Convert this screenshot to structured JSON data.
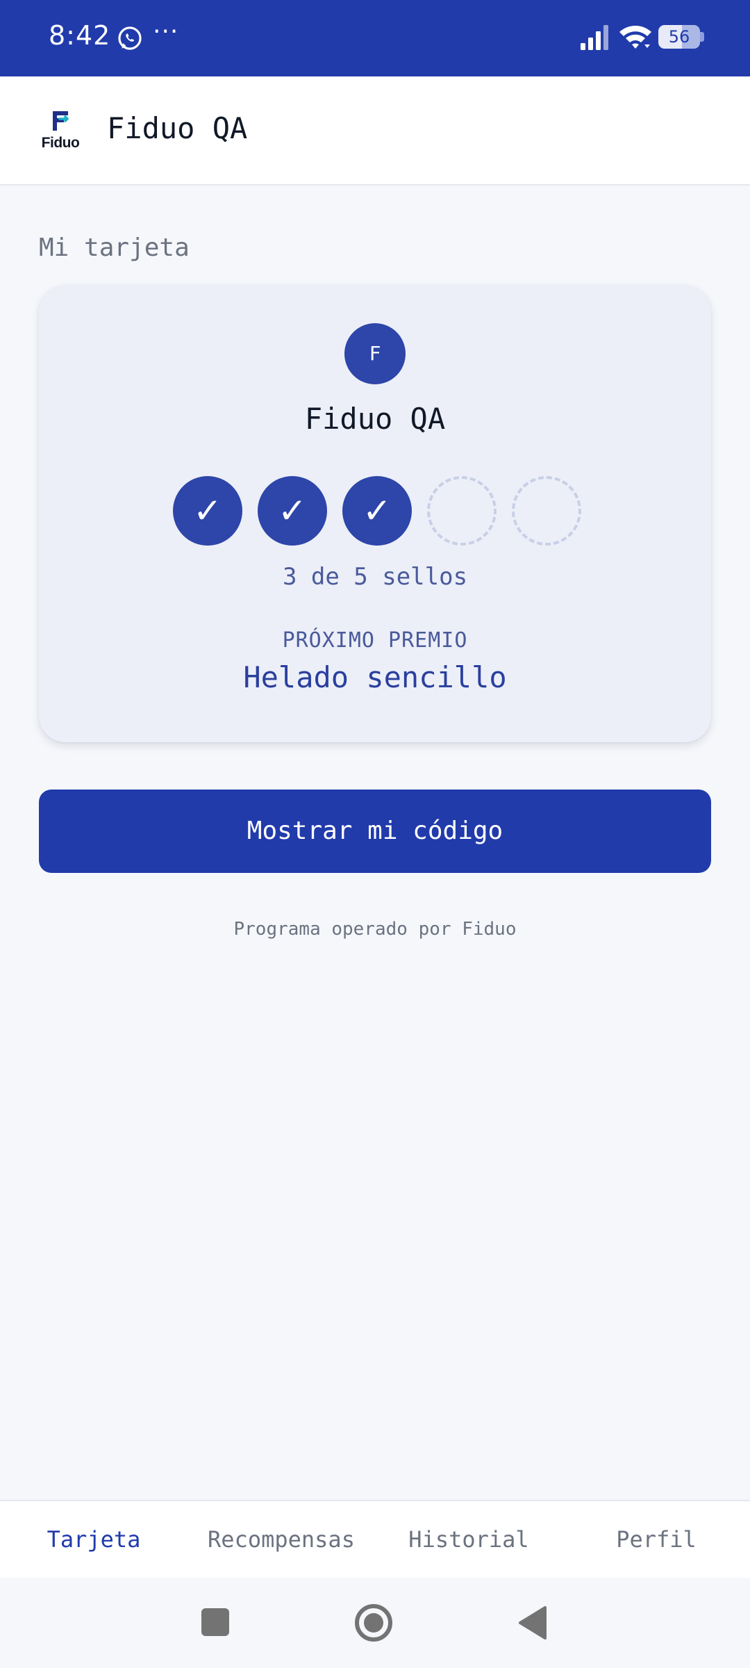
{
  "status_bar": {
    "time": "8:42",
    "more": "···",
    "battery": "56",
    "icons": [
      "whatsapp-icon",
      "signal-icon",
      "wifi-icon",
      "battery-icon"
    ]
  },
  "app_bar": {
    "logo_text": "Fiduo",
    "title": "Fiduo QA"
  },
  "section": {
    "title": "Mi tarjeta"
  },
  "card": {
    "avatar_letter": "F",
    "title": "Fiduo QA",
    "stamps_collected": 3,
    "stamps_total": 5,
    "stamp_check": "✓",
    "stamps_text": "3 de 5 sellos",
    "next_reward_label": "PRÓXIMO PREMIO",
    "next_reward": "Helado sencillo"
  },
  "actions": {
    "show_code": "Mostrar mi código"
  },
  "footer": {
    "note": "Programa operado por Fiduo"
  },
  "bottom_nav": {
    "items": [
      {
        "label": "Tarjeta",
        "active": true
      },
      {
        "label": "Recompensas",
        "active": false
      },
      {
        "label": "Historial",
        "active": false
      },
      {
        "label": "Perfil",
        "active": false
      }
    ]
  },
  "colors": {
    "primary": "#213bab",
    "stamp_filled": "#2e45a9",
    "card_bg": "#eceff8",
    "page_bg": "#f5f7fb"
  }
}
